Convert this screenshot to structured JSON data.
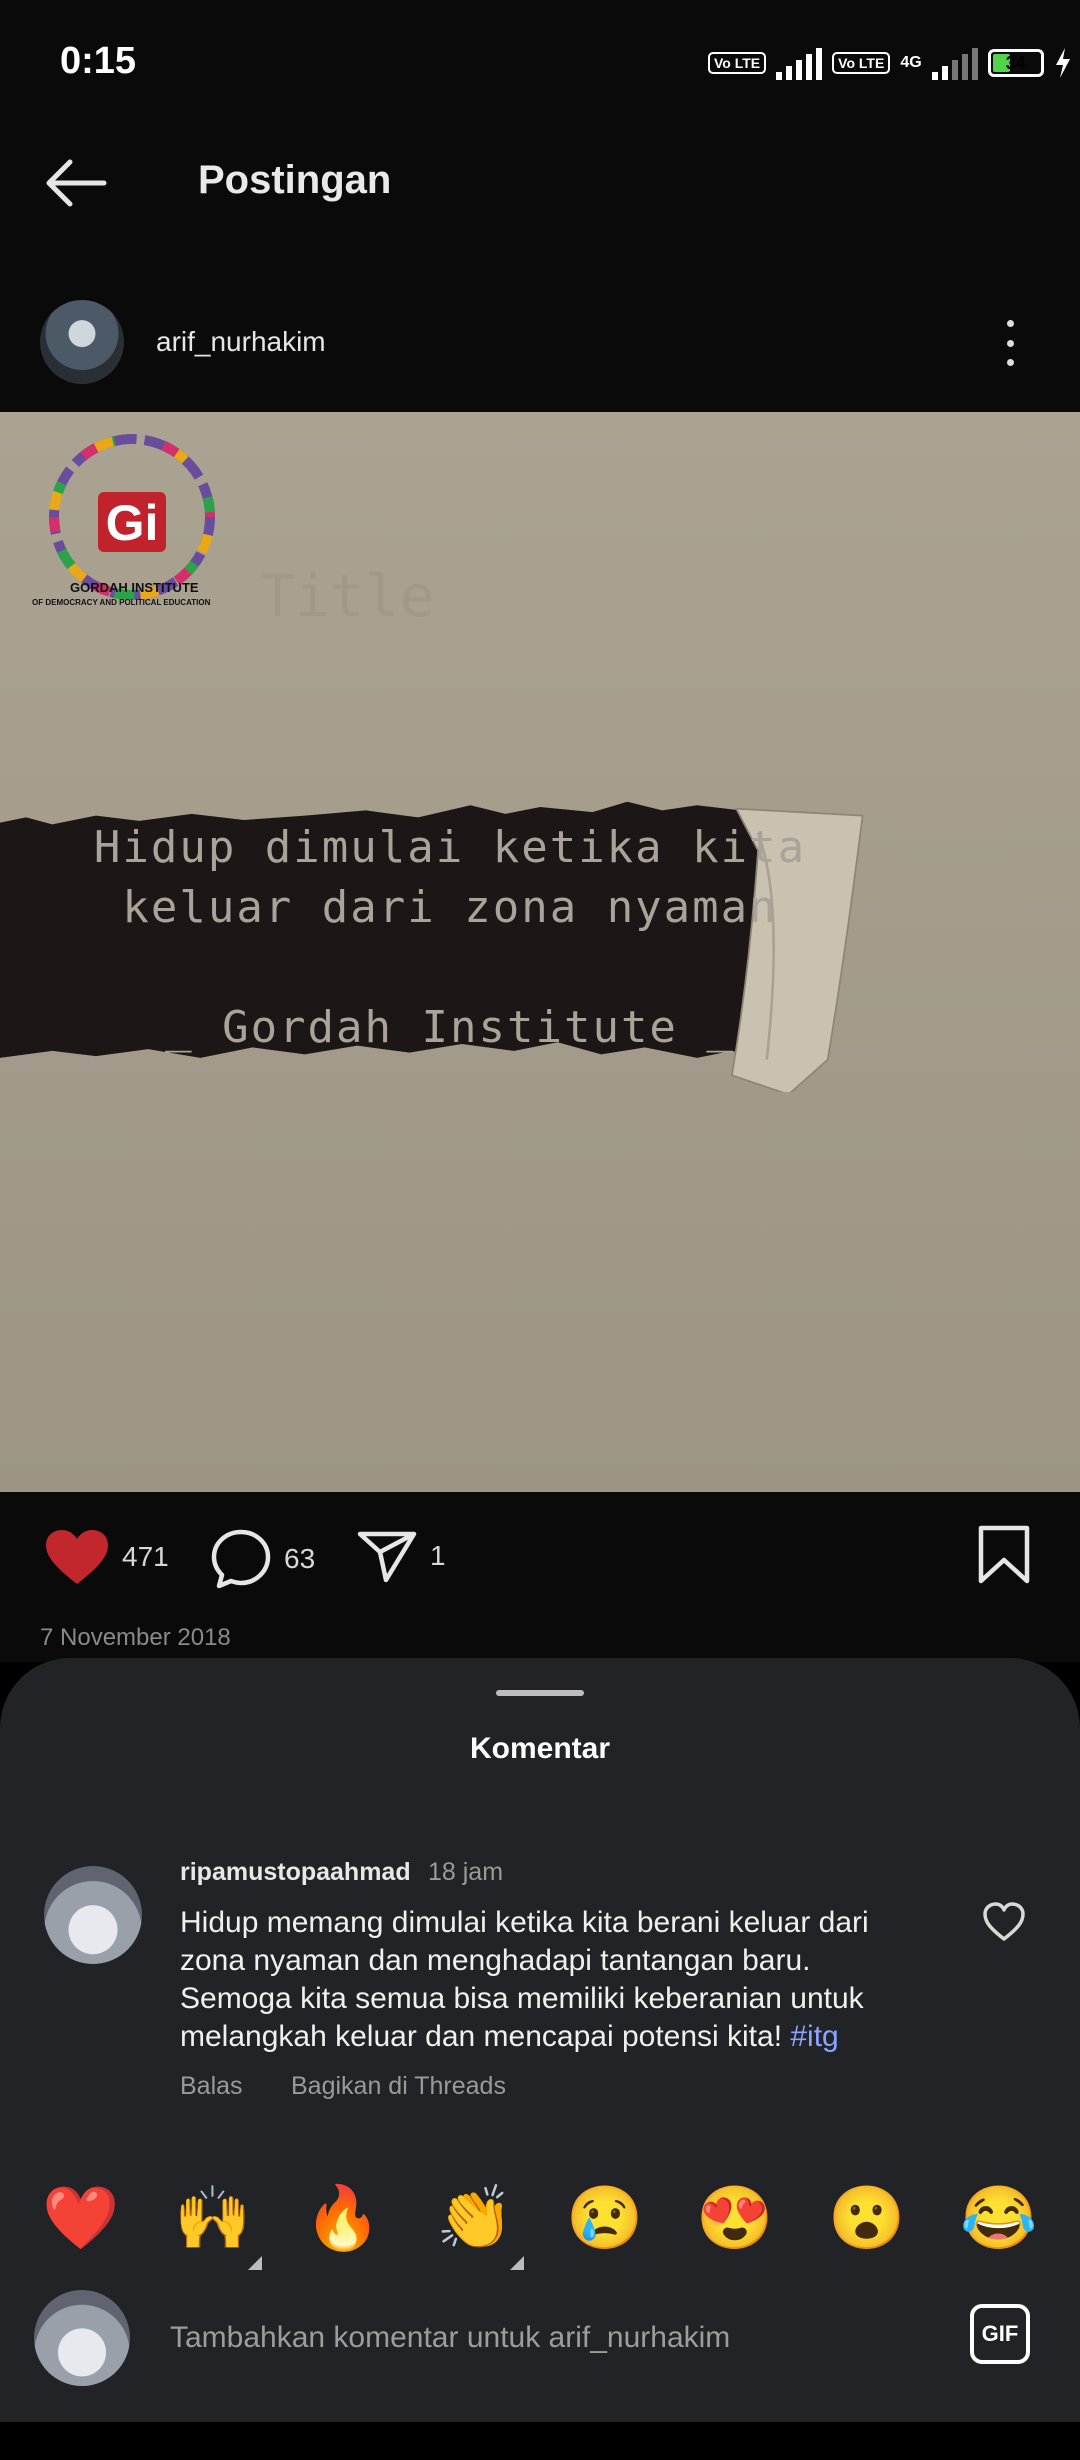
{
  "status_bar": {
    "time": "0:15",
    "sim1_label": "Vo LTE",
    "sim2_label": "Vo LTE",
    "network_label": "4G",
    "battery_level": "34"
  },
  "header": {
    "title": "Postingan",
    "back_icon": "arrow-left-icon"
  },
  "post": {
    "author": "arif_nurhakim",
    "image": {
      "logo_name": "GORDAH INSTITUTE",
      "logo_sub": "OF DEMOCRACY AND POLITICAL EDUCATION",
      "faint_title": "Title",
      "quote_line1": "Hidup dimulai ketika kita",
      "quote_line2": "keluar dari zona nyaman",
      "quote_author": "_ Gordah Institute _"
    },
    "likes": "471",
    "comments": "63",
    "shares": "1",
    "date": "7 November 2018",
    "like_color": "#c1272d"
  },
  "comments_sheet": {
    "title": "Komentar",
    "comment": {
      "username": "ripamustopaahmad",
      "time": "18 jam",
      "text": "Hidup memang dimulai ketika kita berani keluar dari zona nyaman dan menghadapi tantangan baru. Semoga kita semua bisa memiliki keberanian untuk melangkah keluar dan mencapai potensi kita! ",
      "hashtag": "#itg",
      "reply_label": "Balas",
      "share_threads_label": "Bagikan di Threads"
    },
    "emojis": [
      "❤️",
      "🙌",
      "🔥",
      "👏",
      "😢",
      "😍",
      "😮",
      "😂"
    ],
    "input": {
      "placeholder": "Tambahkan komentar untuk arif_nurhakim",
      "gif_label": "GIF"
    }
  }
}
